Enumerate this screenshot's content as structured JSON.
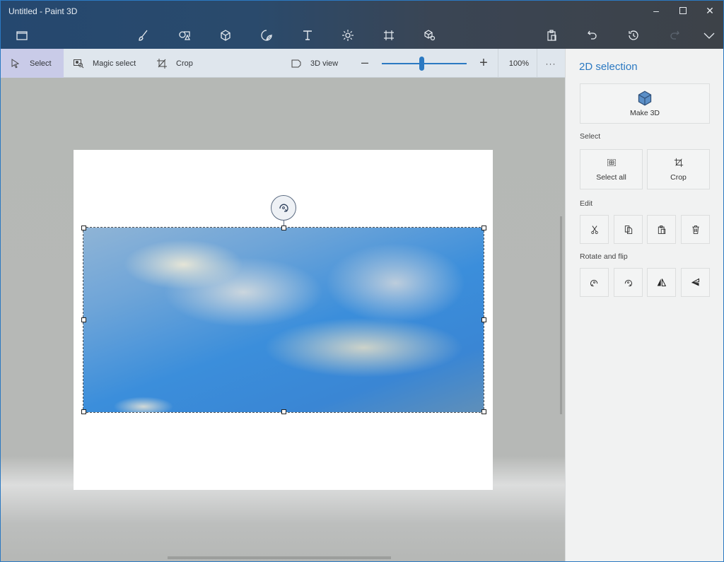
{
  "window": {
    "title": "Untitled - Paint 3D",
    "controls": [
      "minimize-icon",
      "maximize-icon",
      "close-icon"
    ]
  },
  "main_toolbar": {
    "menu_icon": "folder-icon",
    "tools": [
      "brushes-icon",
      "2d-shapes-icon",
      "3d-shapes-icon",
      "stickers-icon",
      "text-icon",
      "effects-icon",
      "canvas-icon",
      "3d-library-icon"
    ],
    "right_tools": [
      "paste-icon",
      "undo-icon",
      "history-icon",
      "redo-icon",
      "expand-chevron-icon"
    ]
  },
  "sub_toolbar": {
    "select_label": "Select",
    "magic_select_label": "Magic select",
    "crop_label": "Crop",
    "view_3d_label": "3D view",
    "zoom_value_percent": 100,
    "zoom_label": "100%",
    "zoom_slider_fraction": 0.47,
    "more_label": "···"
  },
  "panel": {
    "title": "2D selection",
    "make_3d_label": "Make 3D",
    "select_section_label": "Select",
    "select_all_label": "Select all",
    "crop_label": "Crop",
    "edit_section_label": "Edit",
    "edit_buttons": [
      "cut-icon",
      "copy-icon",
      "paste-icon",
      "delete-icon"
    ],
    "rotate_section_label": "Rotate and flip",
    "rotate_buttons": [
      "rotate-left-icon",
      "rotate-right-icon",
      "flip-horizontal-icon",
      "flip-vertical-icon"
    ]
  },
  "colors": {
    "accent": "#2b79c2",
    "topbar": "#25486f",
    "selected_tool_bg": "#c9cbe8",
    "panel_bg": "#f1f2f2"
  }
}
